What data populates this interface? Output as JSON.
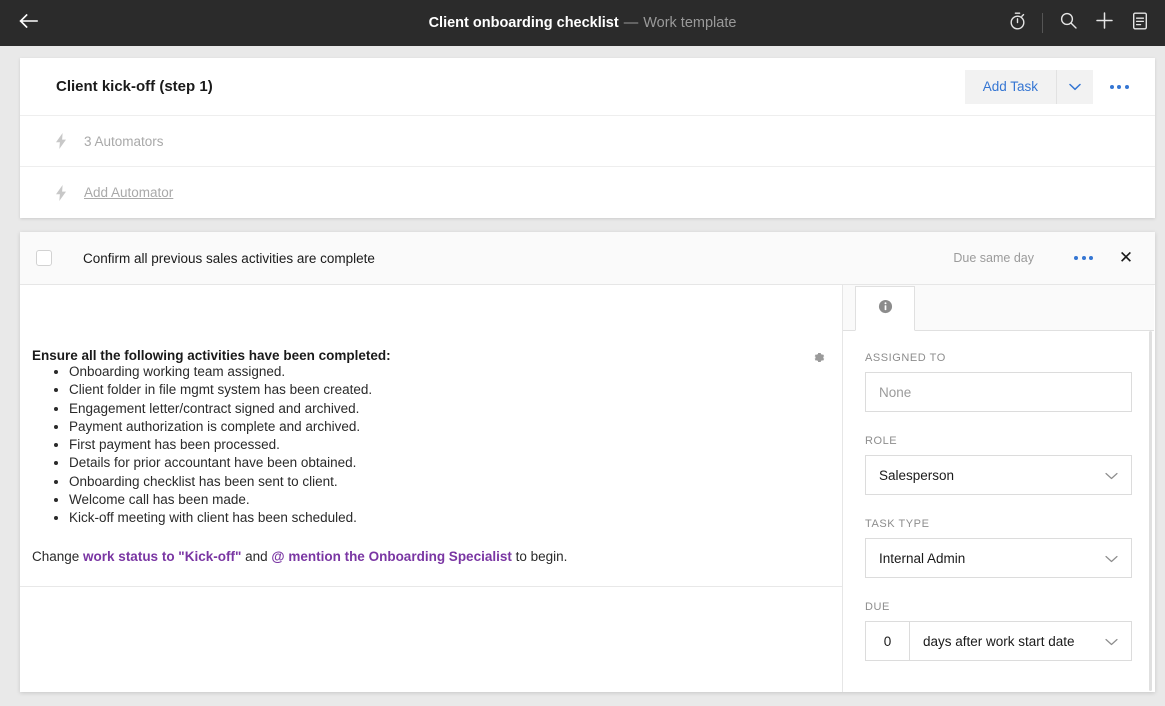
{
  "topbar": {
    "back_icon": "arrow-left-icon",
    "title_main": "Client onboarding checklist",
    "title_sep": "—",
    "title_sub": "Work template",
    "icons": [
      "timer-icon",
      "search-icon",
      "plus-icon",
      "note-icon"
    ]
  },
  "step": {
    "title": "Client kick-off (step 1)",
    "add_task_label": "Add Task",
    "caret_icon": "chevron-down-icon",
    "more_icon": "ellipsis-icon",
    "automators": [
      {
        "icon": "bolt-icon",
        "label": "3 Automators",
        "link": false
      },
      {
        "icon": "bolt-icon",
        "label": "Add Automator",
        "link": true
      }
    ]
  },
  "task": {
    "checkbox_checked": false,
    "name": "Confirm all previous sales activities are complete",
    "due_text": "Due same day",
    "more_icon": "ellipsis-icon",
    "close_icon": "close-icon",
    "close_glyph": "✕"
  },
  "content": {
    "gear_icon": "gear-icon",
    "heading": "Ensure all the following activities have been completed:",
    "items": [
      "Onboarding working team assigned.",
      "Client folder in file mgmt system has been created.",
      "Engagement letter/contract signed and archived.",
      "Payment authorization is complete and archived.",
      "First payment has been processed.",
      "Details for prior accountant have been obtained.",
      "Onboarding checklist has been sent to client.",
      "Welcome call has been made.",
      "Kick-off meeting with client has been scheduled."
    ],
    "para_pre": "Change ",
    "para_link1": "work status to \"Kick-off\"",
    "para_mid": " and ",
    "para_link2": "@ mention the Onboarding Specialist",
    "para_post": " to begin.",
    "link_color": "#7a36a3"
  },
  "sidebar": {
    "tab_icon": "info-icon",
    "assigned_to": {
      "label": "Assigned to",
      "value": "None",
      "placeholder": "None"
    },
    "role": {
      "label": "Role",
      "value": "Salesperson",
      "caret_icon": "chevron-down-icon"
    },
    "task_type": {
      "label": "Task type",
      "value": "Internal Admin",
      "caret_icon": "chevron-down-icon"
    },
    "due": {
      "label": "Due",
      "number": "0",
      "unit": "days after work start date",
      "caret_icon": "chevron-down-icon"
    }
  }
}
